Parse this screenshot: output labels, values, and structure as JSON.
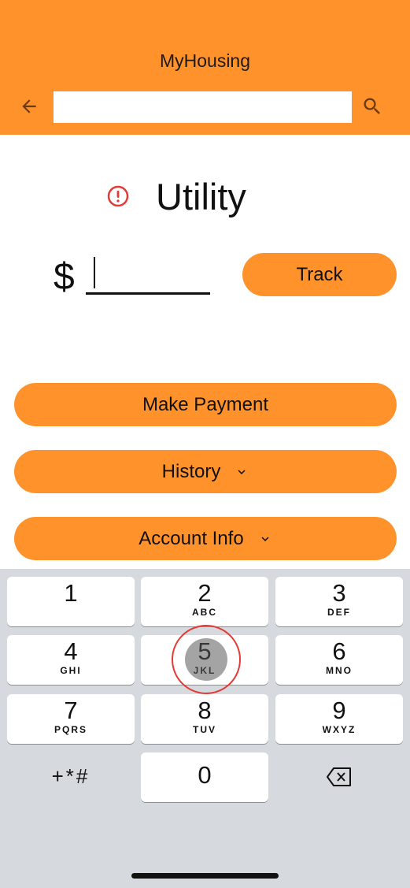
{
  "appbar": {
    "title": "MyHousing",
    "search_value": ""
  },
  "page": {
    "heading": "Utility",
    "currency": "$"
  },
  "buttons": {
    "track": "Track",
    "make_payment": "Make Payment",
    "history": "History",
    "account_info": "Account Info"
  },
  "keyboard": {
    "keys": [
      {
        "num": "1",
        "letters": ""
      },
      {
        "num": "2",
        "letters": "ABC"
      },
      {
        "num": "3",
        "letters": "DEF"
      },
      {
        "num": "4",
        "letters": "GHI"
      },
      {
        "num": "5",
        "letters": "JKL"
      },
      {
        "num": "6",
        "letters": "MNO"
      },
      {
        "num": "7",
        "letters": "PQRS"
      },
      {
        "num": "8",
        "letters": "TUV"
      },
      {
        "num": "9",
        "letters": "WXYZ"
      },
      {
        "num": "0",
        "letters": ""
      }
    ],
    "symbols": "+*#"
  },
  "colors": {
    "accent": "#ff922b",
    "warning": "#e53935",
    "keyboard_bg": "#d6dadf"
  }
}
